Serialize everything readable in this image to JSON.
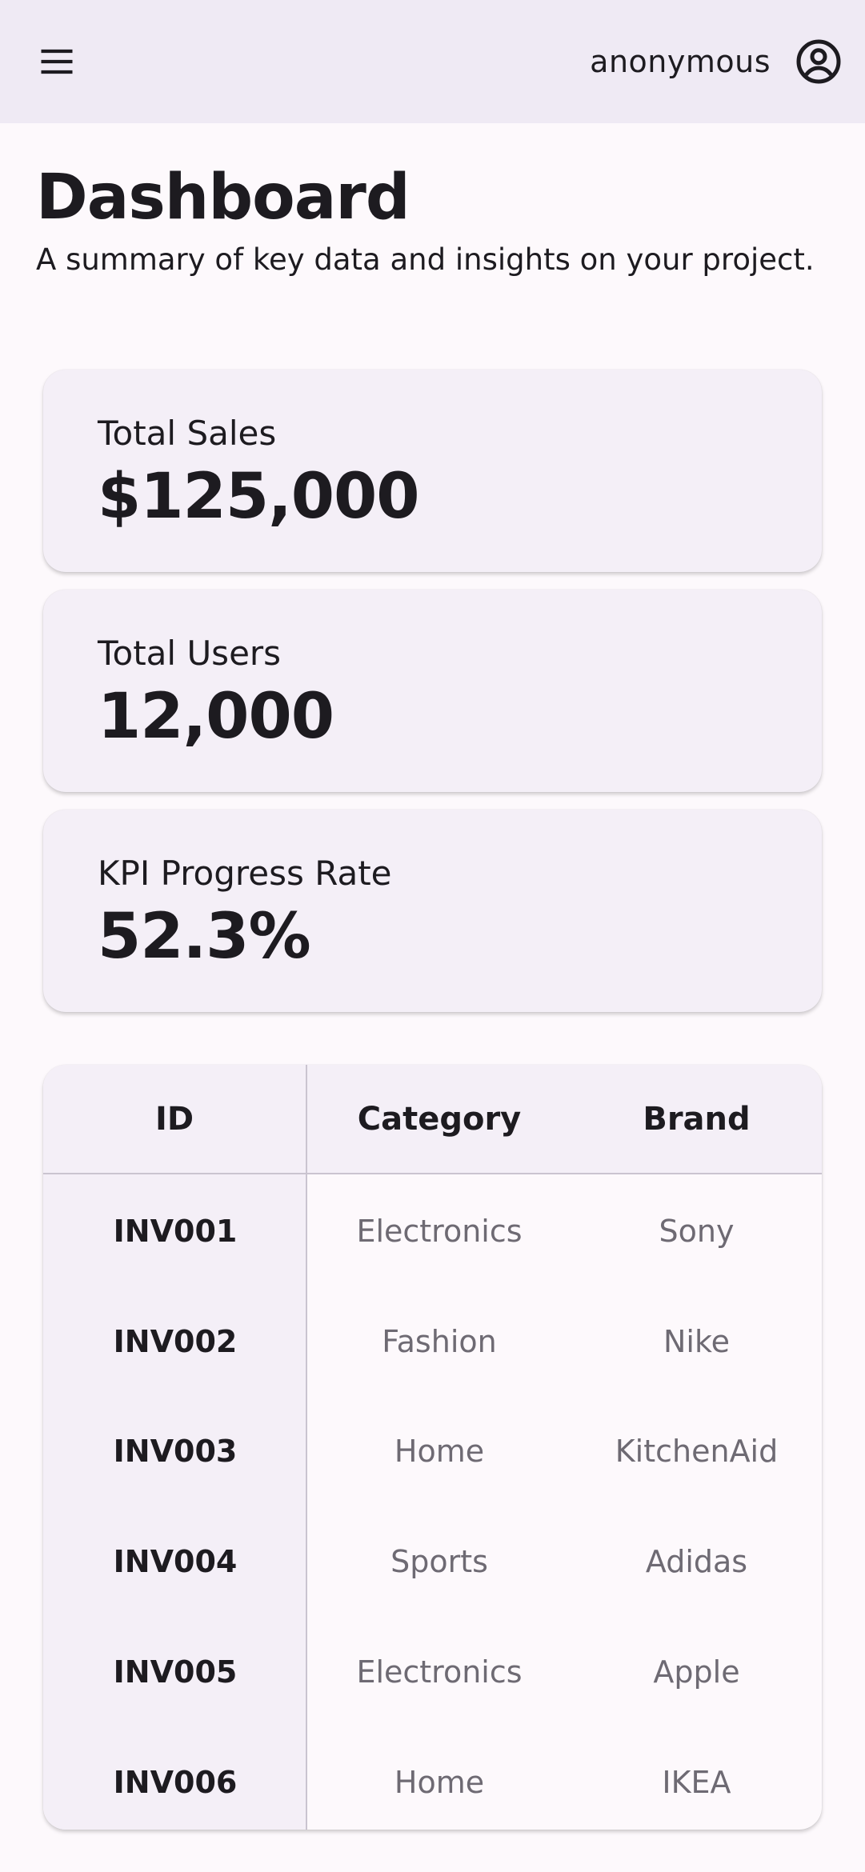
{
  "app_bar": {
    "menu_icon": "hamburger-menu-icon",
    "username": "anonymous",
    "account_icon": "account-circle-icon"
  },
  "page": {
    "title": "Dashboard",
    "subtitle": "A summary of key data and insights on your project."
  },
  "kpis": [
    {
      "label": "Total Sales",
      "value": "$125,000"
    },
    {
      "label": "Total Users",
      "value": "12,000"
    },
    {
      "label": "KPI Progress Rate",
      "value": "52.3%"
    }
  ],
  "table": {
    "columns": [
      "ID",
      "Category",
      "Brand"
    ],
    "rows": [
      {
        "id": "INV001",
        "category": "Electronics",
        "brand": "Sony"
      },
      {
        "id": "INV002",
        "category": "Fashion",
        "brand": "Nike"
      },
      {
        "id": "INV003",
        "category": "Home",
        "brand": "KitchenAid"
      },
      {
        "id": "INV004",
        "category": "Sports",
        "brand": "Adidas"
      },
      {
        "id": "INV005",
        "category": "Electronics",
        "brand": "Apple"
      },
      {
        "id": "INV006",
        "category": "Home",
        "brand": "IKEA"
      }
    ]
  },
  "colors": {
    "app_bar_bg": "#efeaf4",
    "page_bg": "#fdf9fc",
    "card_bg": "#f4eff7",
    "text_primary": "#1d1b20",
    "text_secondary": "#6e6a73",
    "divider": "#cac4d0"
  }
}
